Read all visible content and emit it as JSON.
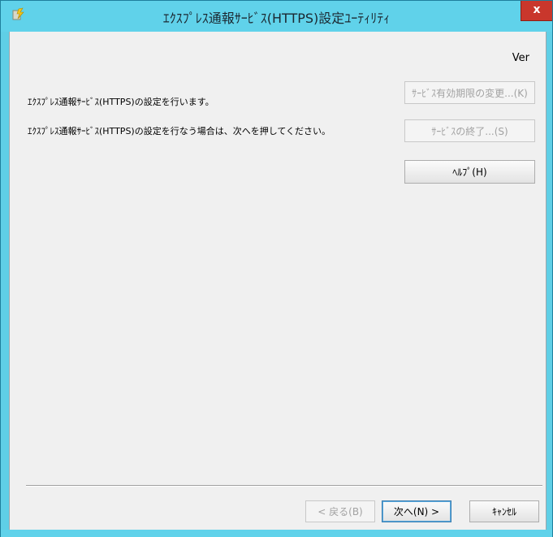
{
  "window": {
    "title": "ｴｸｽﾌﾟﾚｽ通報ｻｰﾋﾞｽ(HTTPS)設定ﾕｰﾃｨﾘﾃｨ",
    "close_label": "x",
    "app_icon": "config-tool-icon"
  },
  "main": {
    "version_label": "Ver",
    "line1": "ｴｸｽﾌﾟﾚｽ通報ｻｰﾋﾞｽ(HTTPS)の設定を行います。",
    "line2": "ｴｸｽﾌﾟﾚｽ通報ｻｰﾋﾞｽ(HTTPS)の設定を行なう場合は、次へを押してください。"
  },
  "side_buttons": {
    "change_expiry": "ｻｰﾋﾞｽ有効期限の変更...(K)",
    "end_service": "ｻｰﾋﾞｽの終了...(S)",
    "help": "ﾍﾙﾌﾟ(H)"
  },
  "footer_buttons": {
    "back": "< 戻る(B)",
    "next": "次へ(N) >",
    "cancel": "ｷｬﾝｾﾙ"
  },
  "colors": {
    "title_bar": "#60d2ea",
    "close_button": "#c9372c",
    "client_bg": "#f0f0f0"
  }
}
